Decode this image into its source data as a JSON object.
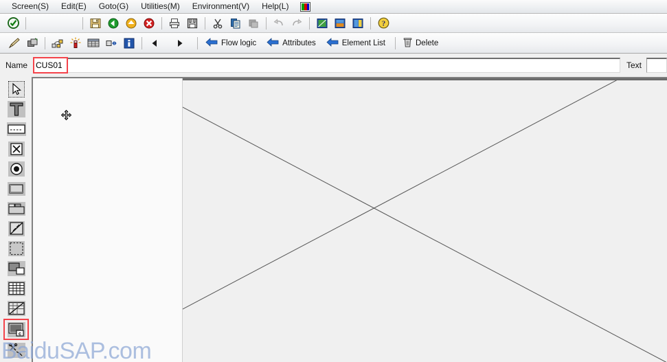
{
  "menubar": {
    "items": [
      {
        "label": "Screen(S)",
        "name": "menu-screen"
      },
      {
        "label": "Edit(E)",
        "name": "menu-edit"
      },
      {
        "label": "Goto(G)",
        "name": "menu-goto"
      },
      {
        "label": "Utilities(M)",
        "name": "menu-utilities"
      },
      {
        "label": "Environment(V)",
        "name": "menu-environment"
      },
      {
        "label": "Help(L)",
        "name": "menu-help"
      }
    ],
    "color_icon": "rgb-color-bar-icon"
  },
  "toolbar_primary": {
    "icons": [
      "confirm-check-icon",
      "save-icon",
      "back-icon",
      "exit-icon",
      "cancel-icon",
      "print-icon",
      "find-icon",
      "cut-icon",
      "copy-icon",
      "paste-icon",
      "undo-icon",
      "redo-icon",
      "layout-green-icon",
      "layout-orange-icon",
      "layout-yellow-icon",
      "help-icon"
    ]
  },
  "toolbar_secondary": {
    "icons": [
      "edit-pencil-icon",
      "copy-object-icon",
      "group-elements-icon",
      "highlight-icon",
      "table-control-icon",
      "arrange-icon",
      "information-icon",
      "previous-icon",
      "next-icon"
    ],
    "buttons": [
      {
        "label": "Flow logic",
        "icon": "arrow-left-icon",
        "name": "flow-logic-button"
      },
      {
        "label": "Attributes",
        "icon": "arrow-left-icon",
        "name": "attributes-button"
      },
      {
        "label": "Element List",
        "icon": "arrow-left-icon",
        "name": "element-list-button"
      },
      {
        "label": "Delete",
        "icon": "trash-icon",
        "name": "delete-button"
      }
    ]
  },
  "form": {
    "name_label": "Name",
    "name_value": "CUS01",
    "name_placeholder": "",
    "text_label": "Text",
    "text_value": "",
    "text_placeholder": "",
    "highlight_color": "#f4434a"
  },
  "palette": {
    "items": [
      {
        "name": "tool-pointer",
        "icon": "pointer-arrow-icon",
        "selected": true,
        "highlighted": false
      },
      {
        "name": "tool-text-field",
        "icon": "text-T-icon",
        "selected": false,
        "highlighted": false
      },
      {
        "name": "tool-input-field",
        "icon": "input-field-icon",
        "selected": false,
        "highlighted": false
      },
      {
        "name": "tool-checkbox",
        "icon": "checkbox-icon",
        "selected": false,
        "highlighted": false
      },
      {
        "name": "tool-radio-button",
        "icon": "radio-button-icon",
        "selected": false,
        "highlighted": false
      },
      {
        "name": "tool-pushbutton",
        "icon": "pushbutton-icon",
        "selected": false,
        "highlighted": false
      },
      {
        "name": "tool-tabstrip",
        "icon": "tabstrip-icon",
        "selected": false,
        "highlighted": false
      },
      {
        "name": "tool-box-diagonal",
        "icon": "box-diagonal-icon",
        "selected": false,
        "highlighted": false
      },
      {
        "name": "tool-group-box",
        "icon": "group-box-icon",
        "selected": false,
        "highlighted": false
      },
      {
        "name": "tool-subscreen",
        "icon": "subscreen-icon",
        "selected": false,
        "highlighted": false
      },
      {
        "name": "tool-table-control",
        "icon": "table-grid-icon",
        "selected": false,
        "highlighted": false
      },
      {
        "name": "tool-table-diagonal",
        "icon": "table-diagonal-icon",
        "selected": false,
        "highlighted": false
      },
      {
        "name": "tool-custom-control",
        "icon": "custom-control-icon",
        "selected": false,
        "highlighted": true
      },
      {
        "name": "tool-status-icon",
        "icon": "status-tool-icon",
        "selected": false,
        "highlighted": false
      }
    ]
  },
  "canvas": {
    "cursor": "move-crosshair-cursor",
    "diagonals": "empty-screen-x-marker"
  },
  "watermark": {
    "text": "BaiduSAP.com",
    "color": "#8da7d6"
  }
}
